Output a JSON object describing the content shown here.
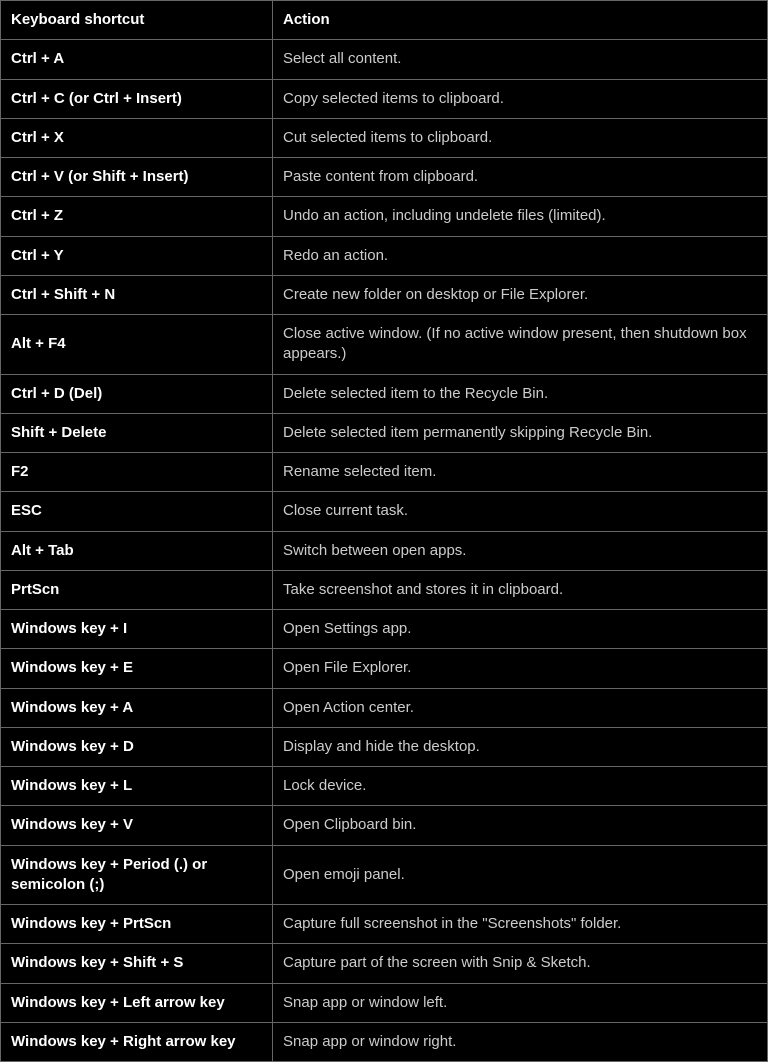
{
  "table": {
    "headers": {
      "shortcut": "Keyboard shortcut",
      "action": "Action"
    },
    "rows": [
      {
        "shortcut": "Ctrl + A",
        "action": "Select all content."
      },
      {
        "shortcut": "Ctrl + C (or Ctrl + Insert)",
        "action": "Copy selected items to clipboard."
      },
      {
        "shortcut": "Ctrl + X",
        "action": "Cut selected items to clipboard."
      },
      {
        "shortcut": "Ctrl + V (or Shift + Insert)",
        "action": "Paste content from clipboard."
      },
      {
        "shortcut": "Ctrl + Z",
        "action": "Undo an action, including undelete files (limited)."
      },
      {
        "shortcut": "Ctrl + Y",
        "action": "Redo an action."
      },
      {
        "shortcut": "Ctrl + Shift + N",
        "action": "Create new folder on desktop or File Explorer."
      },
      {
        "shortcut": "Alt + F4",
        "action": "Close active window. (If no active window present, then shutdown box appears.)"
      },
      {
        "shortcut": "Ctrl + D (Del)",
        "action": "Delete selected item to the Recycle Bin."
      },
      {
        "shortcut": "Shift + Delete",
        "action": "Delete selected item permanently skipping Recycle Bin."
      },
      {
        "shortcut": "F2",
        "action": "Rename selected item."
      },
      {
        "shortcut": "ESC",
        "action": "Close current task."
      },
      {
        "shortcut": "Alt + Tab",
        "action": "Switch between open apps."
      },
      {
        "shortcut": "PrtScn",
        "action": "Take screenshot and stores it in clipboard."
      },
      {
        "shortcut": "Windows key + I",
        "action": "Open Settings app."
      },
      {
        "shortcut": "Windows key + E",
        "action": "Open File Explorer."
      },
      {
        "shortcut": "Windows key + A",
        "action": "Open Action center."
      },
      {
        "shortcut": "Windows key + D",
        "action": "Display and hide the desktop."
      },
      {
        "shortcut": "Windows key + L",
        "action": "Lock device."
      },
      {
        "shortcut": "Windows key + V",
        "action": "Open Clipboard bin."
      },
      {
        "shortcut": "Windows key + Period (.) or semicolon (;)",
        "action": "Open emoji panel."
      },
      {
        "shortcut": "Windows key + PrtScn",
        "action": "Capture full screenshot in the \"Screenshots\" folder."
      },
      {
        "shortcut": "Windows key + Shift + S",
        "action": "Capture part of the screen with Snip & Sketch."
      },
      {
        "shortcut": "Windows key + Left arrow key",
        "action": "Snap app or window left."
      },
      {
        "shortcut": "Windows key + Right arrow key",
        "action": "Snap app or window right."
      }
    ]
  }
}
